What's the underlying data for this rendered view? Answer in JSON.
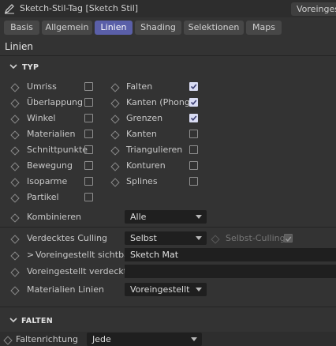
{
  "window": {
    "title": "Sketch-Stil-Tag [Sketch Stil]",
    "preset_label": "Voreingest"
  },
  "tabs": [
    {
      "label": "Basis"
    },
    {
      "label": "Allgemein"
    },
    {
      "label": "Linien",
      "active": true
    },
    {
      "label": "Shading"
    },
    {
      "label": "Selektionen"
    },
    {
      "label": "Maps"
    }
  ],
  "section_title": "Linien",
  "typ": {
    "header": "TYP",
    "left": [
      {
        "label": "Umriss",
        "checked": false
      },
      {
        "label": "Überlappung",
        "checked": false
      },
      {
        "label": "Winkel",
        "checked": false
      },
      {
        "label": "Materialien",
        "checked": false
      },
      {
        "label": "Schnittpunkte",
        "checked": false
      },
      {
        "label": "Bewegung",
        "checked": false
      },
      {
        "label": "Isoparme",
        "checked": false
      },
      {
        "label": "Partikel",
        "checked": false
      }
    ],
    "right": [
      {
        "label": "Falten",
        "checked": true
      },
      {
        "label": "Kanten (Phong)",
        "checked": true
      },
      {
        "label": "Grenzen",
        "checked": true
      },
      {
        "label": "Kanten",
        "checked": false
      },
      {
        "label": "Triangulieren",
        "checked": false
      },
      {
        "label": "Konturen",
        "checked": false
      },
      {
        "label": "Splines",
        "checked": false
      }
    ]
  },
  "props": {
    "kombinieren": {
      "label": "Kombinieren",
      "value": "Alle"
    },
    "culling": {
      "label": "Verdecktes Culling",
      "value": "Selbst",
      "self_label": "Selbst-Culling",
      "self_checked": true
    },
    "sichtbar": {
      "label": "Voreingestellt sichtbar",
      "expander": ">",
      "value": "Sketch Mat"
    },
    "verdeckt": {
      "label": "Voreingestellt verdeckt",
      "value": ""
    },
    "mat_linien": {
      "label": "Materialien Linien",
      "value": "Voreingestellt"
    }
  },
  "falten": {
    "header": "FALTEN",
    "richtung": {
      "label": "Faltenrichtung",
      "value": "Jede"
    }
  },
  "colors": {
    "accent": "#5a5fa8",
    "checkbox_checked": "#d9dcf3",
    "background": "#333333",
    "field": "#1f1f1f"
  }
}
